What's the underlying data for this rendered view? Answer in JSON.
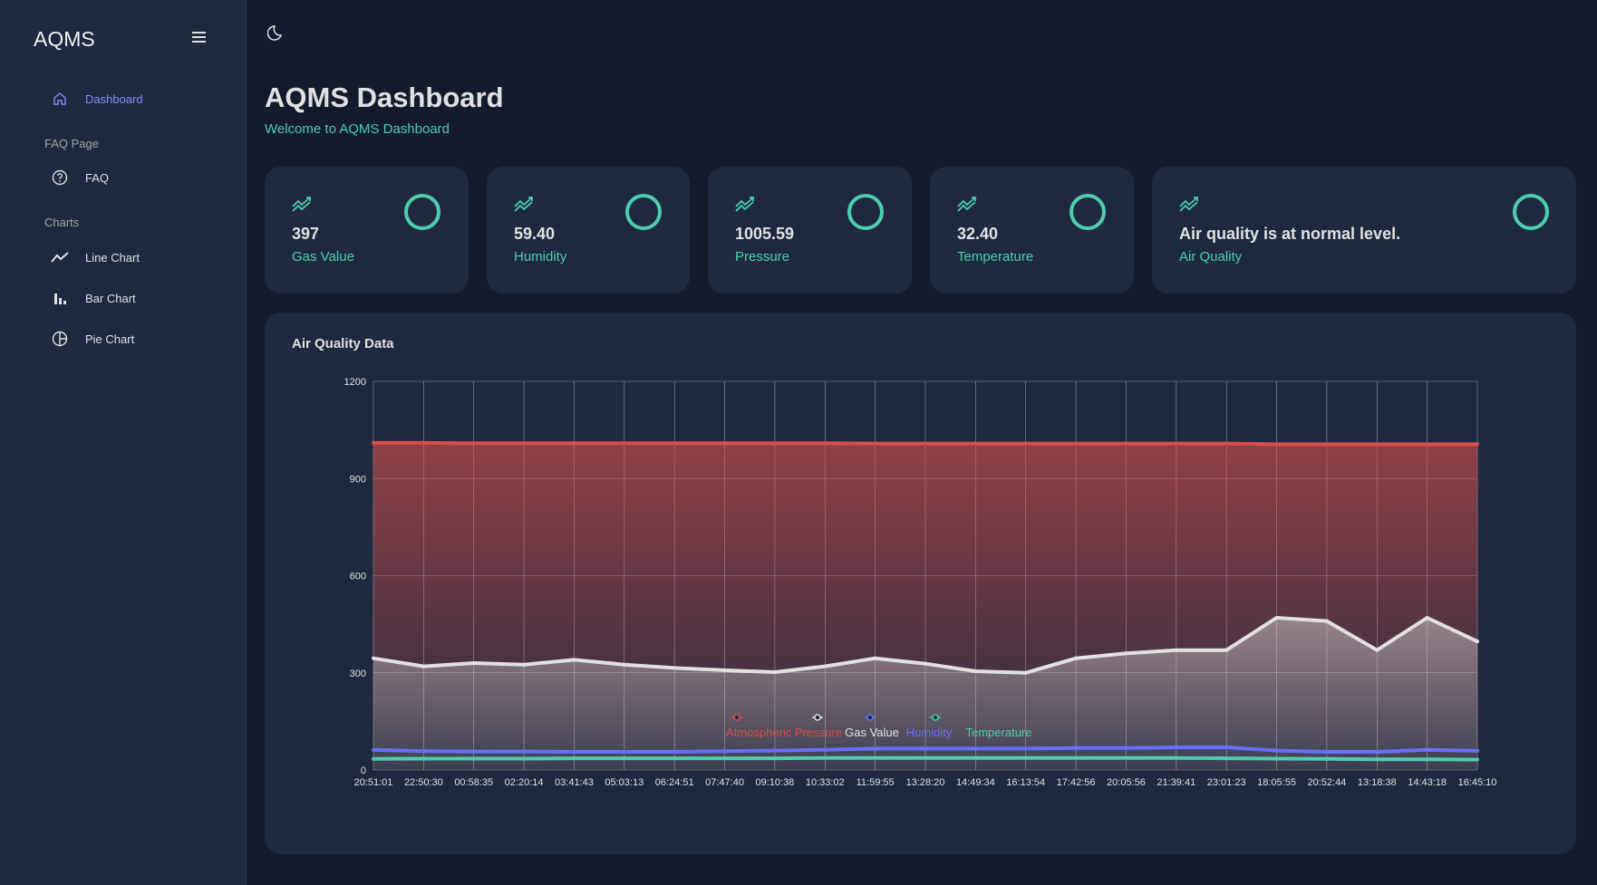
{
  "app": {
    "brand": "AQMS"
  },
  "sidebar": {
    "items": [
      {
        "label": "Dashboard",
        "icon": "home-icon",
        "active": true
      },
      {
        "section": "FAQ Page"
      },
      {
        "label": "FAQ",
        "icon": "help-circle-icon"
      },
      {
        "section": "Charts"
      },
      {
        "label": "Line Chart",
        "icon": "line-chart-icon"
      },
      {
        "label": "Bar Chart",
        "icon": "bar-chart-icon"
      },
      {
        "label": "Pie Chart",
        "icon": "pie-chart-icon"
      }
    ]
  },
  "topbar": {
    "theme_icon": "moon-icon"
  },
  "header": {
    "title": "AQMS Dashboard",
    "subtitle": "Welcome to AQMS Dashboard"
  },
  "stats": [
    {
      "value": "397",
      "label": "Gas Value"
    },
    {
      "value": "59.40",
      "label": "Humidity"
    },
    {
      "value": "1005.59",
      "label": "Pressure"
    },
    {
      "value": "32.40",
      "label": "Temperature"
    },
    {
      "value": "Air quality is at normal level.",
      "label": "Air Quality"
    }
  ],
  "colors": {
    "accent": "#4cceac",
    "pressure": "#db4f4a",
    "gas": "#e0e0e0",
    "humidity": "#6870fa",
    "temperature": "#4cceac"
  },
  "chart_card": {
    "title": "Air Quality Data"
  },
  "chart_data": {
    "type": "area",
    "ylim": [
      0,
      1200
    ],
    "yticks": [
      0,
      300,
      600,
      900,
      1200
    ],
    "grid": true,
    "legend_position": "bottom",
    "xticks": [
      "20:51:01",
      "22:50:30",
      "00:58:35",
      "02:20:14",
      "03:41:43",
      "05:03:13",
      "06:24:51",
      "07:47:40",
      "09:10:38",
      "10:33:02",
      "11:59:55",
      "13:28:20",
      "14:49:34",
      "16:13:54",
      "17:42:56",
      "20:05:56",
      "21:39:41",
      "23:01:23",
      "18:05:55",
      "20:52:44",
      "13:18:38",
      "14:43:18",
      "16:45:10"
    ],
    "series": [
      {
        "name": "Atmospheric Pressure",
        "values": [
          1010,
          1010,
          1009,
          1009,
          1009,
          1009,
          1009,
          1009,
          1009,
          1009,
          1008,
          1008,
          1008,
          1008,
          1008,
          1008,
          1008,
          1008,
          1006,
          1006,
          1006,
          1006,
          1006
        ]
      },
      {
        "name": "Gas Value",
        "values": [
          345,
          320,
          330,
          325,
          340,
          325,
          315,
          308,
          302,
          320,
          345,
          328,
          305,
          300,
          345,
          360,
          370,
          370,
          470,
          460,
          370,
          470,
          397
        ]
      },
      {
        "name": "Humidity",
        "values": [
          62,
          58,
          57,
          57,
          56,
          56,
          56,
          58,
          60,
          62,
          66,
          66,
          66,
          66,
          68,
          68,
          70,
          70,
          60,
          56,
          56,
          62,
          59
        ]
      },
      {
        "name": "Temperature",
        "values": [
          34,
          35,
          35,
          35,
          36,
          36,
          36,
          36,
          36,
          37,
          37,
          37,
          37,
          37,
          37,
          37,
          37,
          36,
          35,
          34,
          33,
          33,
          32
        ]
      }
    ]
  }
}
